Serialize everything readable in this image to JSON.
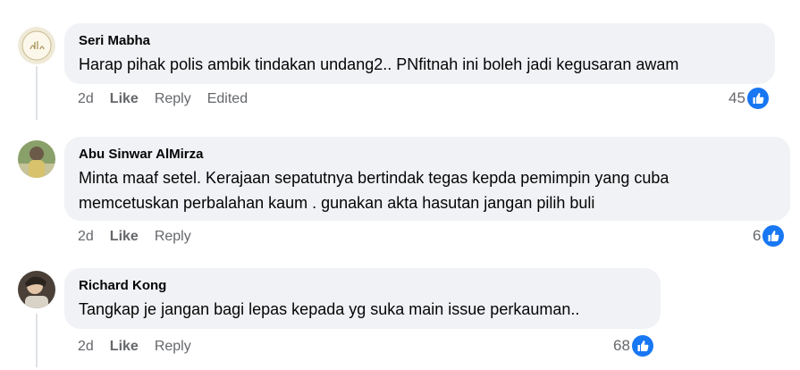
{
  "comments": [
    {
      "author": "Seri Mabha",
      "text": "Harap pihak polis ambik tindakan undang2.. PNfitnah ini boleh jadi kegusaran awam",
      "time": "2d",
      "like_label": "Like",
      "reply_label": "Reply",
      "edited_label": "Edited",
      "reactions": "45",
      "avatar_icon": "allah-calligraphy-avatar"
    },
    {
      "author": "Abu Sinwar AlMirza",
      "text_line1": "Minta maaf setel. Kerajaan sepatutnya bertindak tegas kepda pemimpin yang cuba",
      "text_line2": "memcetuskan perbalahan kaum . gunakan akta hasutan jangan pilih buli",
      "time": "2d",
      "like_label": "Like",
      "reply_label": "Reply",
      "reactions": "6",
      "avatar_icon": "profile-photo-avatar"
    },
    {
      "author": "Richard Kong",
      "text": "Tangkap je jangan bagi lepas kepada yg suka main issue perkauman..",
      "time": "2d",
      "like_label": "Like",
      "reply_label": "Reply",
      "reactions": "68",
      "avatar_icon": "profile-photo-avatar"
    }
  ],
  "colors": {
    "bubble": "#f0f2f5",
    "muted_text": "#65676b",
    "like_blue": "#1877f2"
  }
}
